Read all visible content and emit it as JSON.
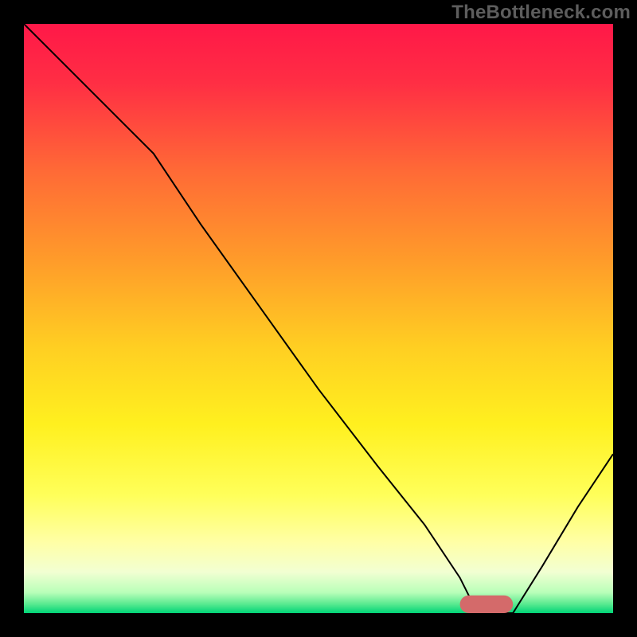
{
  "watermark": "TheBottleneck.com",
  "chart_data": {
    "type": "line",
    "title": "",
    "xlabel": "",
    "ylabel": "",
    "xlim": [
      0,
      100
    ],
    "ylim": [
      0,
      100
    ],
    "grid": false,
    "legend": false,
    "background": {
      "type": "vertical-gradient",
      "stops": [
        {
          "pos": 0.0,
          "color": "#ff1848"
        },
        {
          "pos": 0.1,
          "color": "#ff2e44"
        },
        {
          "pos": 0.25,
          "color": "#ff6a36"
        },
        {
          "pos": 0.4,
          "color": "#ff9b2a"
        },
        {
          "pos": 0.55,
          "color": "#ffcf22"
        },
        {
          "pos": 0.68,
          "color": "#fff01f"
        },
        {
          "pos": 0.8,
          "color": "#ffff5a"
        },
        {
          "pos": 0.88,
          "color": "#ffffa6"
        },
        {
          "pos": 0.93,
          "color": "#f2ffd2"
        },
        {
          "pos": 0.965,
          "color": "#b9ffb9"
        },
        {
          "pos": 0.985,
          "color": "#57e98f"
        },
        {
          "pos": 1.0,
          "color": "#00d477"
        }
      ]
    },
    "series": [
      {
        "name": "bottleneck-curve",
        "comment": "y = 100 at left, descends to 0 near x≈77, flat to ≈83, rises to ≈27 at x=100; slight knee ~x≈22,y≈78",
        "x": [
          0,
          8,
          16,
          22,
          30,
          40,
          50,
          60,
          68,
          74,
          77,
          80,
          83,
          88,
          94,
          100
        ],
        "y": [
          100,
          92,
          84,
          78,
          66,
          52,
          38,
          25,
          15,
          6,
          0,
          0,
          0,
          8,
          18,
          27
        ]
      }
    ],
    "marker": {
      "name": "optimal-range",
      "shape": "rounded-bar",
      "color": "#d46a6a",
      "x_start": 74,
      "x_end": 83,
      "y": 1.5,
      "height": 3
    }
  }
}
